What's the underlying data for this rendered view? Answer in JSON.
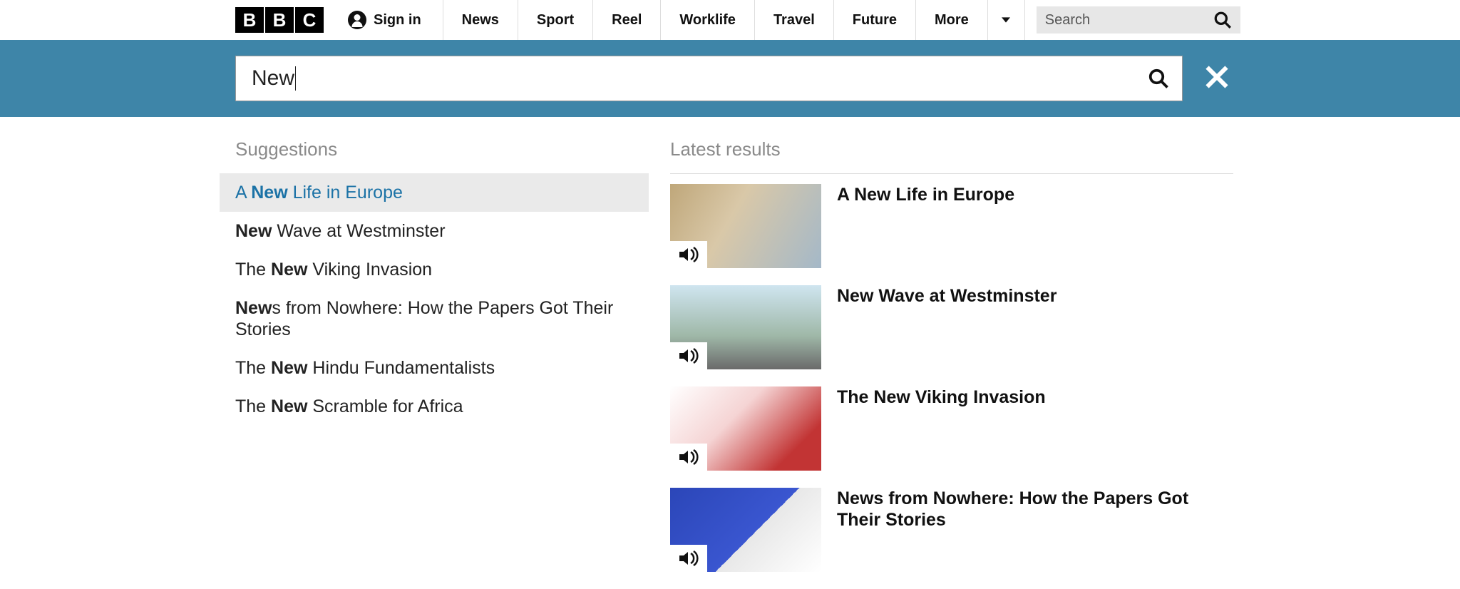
{
  "header": {
    "logo_letters": [
      "B",
      "B",
      "C"
    ],
    "signin_label": "Sign in",
    "nav": [
      "News",
      "Sport",
      "Reel",
      "Worklife",
      "Travel",
      "Future",
      "More"
    ],
    "search_placeholder": "Search"
  },
  "search": {
    "query": "New"
  },
  "suggestions": {
    "title": "Suggestions",
    "items": [
      {
        "pre": "A ",
        "bold": "New",
        "post": " Life in Europe",
        "active": true
      },
      {
        "pre": "",
        "bold": "New",
        "post": " Wave at Westminster",
        "active": false
      },
      {
        "pre": "The ",
        "bold": "New",
        "post": " Viking Invasion",
        "active": false
      },
      {
        "pre": "",
        "bold": "New",
        "post": "s from Nowhere: How the Papers Got Their Stories",
        "active": false
      },
      {
        "pre": "The ",
        "bold": "New",
        "post": " Hindu Fundamentalists",
        "active": false
      },
      {
        "pre": "The ",
        "bold": "New",
        "post": " Scramble for Africa",
        "active": false
      }
    ]
  },
  "results": {
    "title": "Latest results",
    "items": [
      {
        "title": "A New Life in Europe"
      },
      {
        "title": "New Wave at Westminster"
      },
      {
        "title": "The New Viking Invasion"
      },
      {
        "title": "News from Nowhere: How the Papers Got Their Stories"
      }
    ]
  }
}
